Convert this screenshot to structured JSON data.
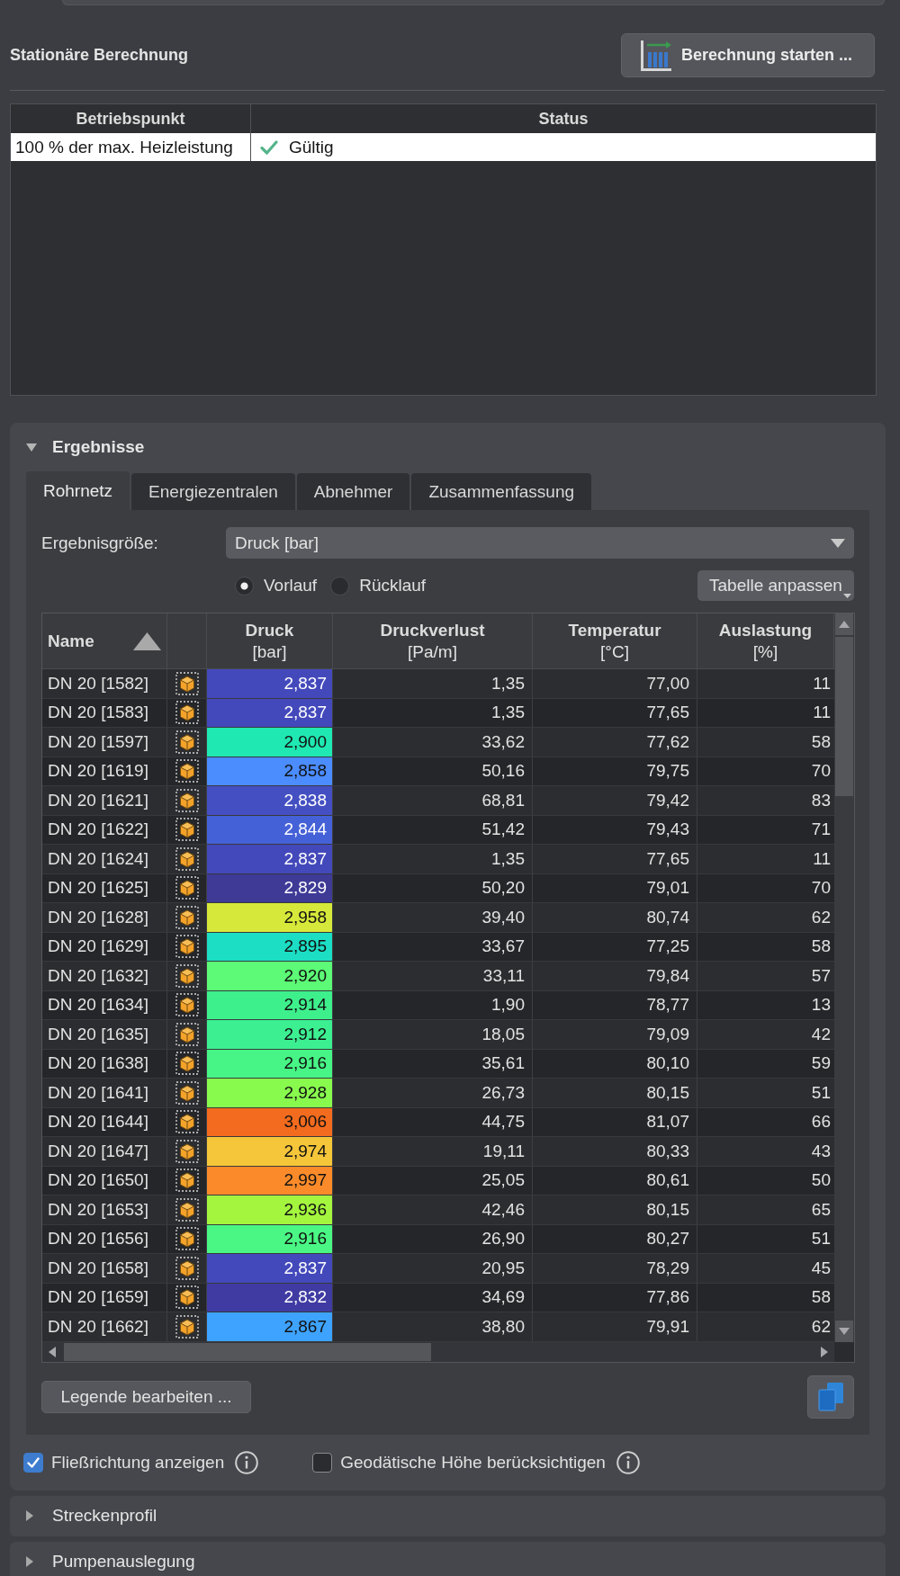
{
  "calculation": {
    "title": "Stationäre Berechnung",
    "start_button": "Berechnung starten ...",
    "table": {
      "columns": [
        "Betriebspunkt",
        "Status"
      ],
      "rows": [
        {
          "operating_point": "100 % der max. Heizleistung",
          "status": "Gültig",
          "valid": true,
          "selected": true
        }
      ]
    }
  },
  "results": {
    "title": "Ergebnisse",
    "expanded": true,
    "tabs": [
      {
        "label": "Rohrnetz",
        "selected": true
      },
      {
        "label": "Energiezentralen",
        "selected": false
      },
      {
        "label": "Abnehmer",
        "selected": false
      },
      {
        "label": "Zusammenfassung",
        "selected": false
      }
    ],
    "quantity": {
      "label": "Ergebnisgröße:",
      "value": "Druck [bar]"
    },
    "flow_options": [
      {
        "label": "Vorlauf",
        "selected": true
      },
      {
        "label": "Rücklauf",
        "selected": false
      }
    ],
    "customize_button": "Tabelle anpassen",
    "table": {
      "columns": [
        {
          "label": "Name",
          "sorted": true
        },
        {
          "label": "Druck",
          "unit": "[bar]",
          "sorted": false
        },
        {
          "label": "Druckverlust",
          "unit": "[Pa/m]",
          "sorted": false
        },
        {
          "label": "Temperatur",
          "unit": "[°C]",
          "sorted": false
        },
        {
          "label": "Auslastung",
          "unit": "[%]",
          "sorted": false
        }
      ],
      "rows": [
        {
          "name": "DN 20 [1582]",
          "pressure": "2,837",
          "color": "#4349bb",
          "pressure_loss": "1,35",
          "temperature": "77,00",
          "load": "11"
        },
        {
          "name": "DN 20 [1583]",
          "pressure": "2,837",
          "color": "#4349bb",
          "pressure_loss": "1,35",
          "temperature": "77,65",
          "load": "11"
        },
        {
          "name": "DN 20 [1597]",
          "pressure": "2,900",
          "color": "#20e8b2",
          "pressure_loss": "33,62",
          "temperature": "77,62",
          "load": "58"
        },
        {
          "name": "DN 20 [1619]",
          "pressure": "2,858",
          "color": "#4b8cff",
          "pressure_loss": "50,16",
          "temperature": "79,75",
          "load": "70"
        },
        {
          "name": "DN 20 [1621]",
          "pressure": "2,838",
          "color": "#4450c2",
          "pressure_loss": "68,81",
          "temperature": "79,42",
          "load": "83"
        },
        {
          "name": "DN 20 [1622]",
          "pressure": "2,844",
          "color": "#4561d8",
          "pressure_loss": "51,42",
          "temperature": "79,43",
          "load": "71"
        },
        {
          "name": "DN 20 [1624]",
          "pressure": "2,837",
          "color": "#4349bb",
          "pressure_loss": "1,35",
          "temperature": "77,65",
          "load": "11"
        },
        {
          "name": "DN 20 [1625]",
          "pressure": "2,829",
          "color": "#3e3a96",
          "pressure_loss": "50,20",
          "temperature": "79,01",
          "load": "70"
        },
        {
          "name": "DN 20 [1628]",
          "pressure": "2,958",
          "color": "#d6e83a",
          "pressure_loss": "39,40",
          "temperature": "80,74",
          "load": "62"
        },
        {
          "name": "DN 20 [1629]",
          "pressure": "2,895",
          "color": "#1cdec4",
          "pressure_loss": "33,67",
          "temperature": "77,25",
          "load": "58"
        },
        {
          "name": "DN 20 [1632]",
          "pressure": "2,920",
          "color": "#5cfa76",
          "pressure_loss": "33,11",
          "temperature": "79,84",
          "load": "57"
        },
        {
          "name": "DN 20 [1634]",
          "pressure": "2,914",
          "color": "#3ef08c",
          "pressure_loss": "1,90",
          "temperature": "78,77",
          "load": "13"
        },
        {
          "name": "DN 20 [1635]",
          "pressure": "2,912",
          "color": "#3cf092",
          "pressure_loss": "18,05",
          "temperature": "79,09",
          "load": "42"
        },
        {
          "name": "DN 20 [1638]",
          "pressure": "2,916",
          "color": "#47f586",
          "pressure_loss": "35,61",
          "temperature": "80,10",
          "load": "59"
        },
        {
          "name": "DN 20 [1641]",
          "pressure": "2,928",
          "color": "#88fa4e",
          "pressure_loss": "26,73",
          "temperature": "80,15",
          "load": "51"
        },
        {
          "name": "DN 20 [1644]",
          "pressure": "3,006",
          "color": "#f36b1e",
          "pressure_loss": "44,75",
          "temperature": "81,07",
          "load": "66"
        },
        {
          "name": "DN 20 [1647]",
          "pressure": "2,974",
          "color": "#f5c63a",
          "pressure_loss": "19,11",
          "temperature": "80,33",
          "load": "43"
        },
        {
          "name": "DN 20 [1650]",
          "pressure": "2,997",
          "color": "#fb8b2a",
          "pressure_loss": "25,05",
          "temperature": "80,61",
          "load": "50"
        },
        {
          "name": "DN 20 [1653]",
          "pressure": "2,936",
          "color": "#a4f53e",
          "pressure_loss": "42,46",
          "temperature": "80,15",
          "load": "65"
        },
        {
          "name": "DN 20 [1656]",
          "pressure": "2,916",
          "color": "#4af784",
          "pressure_loss": "26,90",
          "temperature": "80,27",
          "load": "51"
        },
        {
          "name": "DN 20 [1658]",
          "pressure": "2,837",
          "color": "#4349bb",
          "pressure_loss": "20,95",
          "temperature": "78,29",
          "load": "45"
        },
        {
          "name": "DN 20 [1659]",
          "pressure": "2,832",
          "color": "#3f3ba2",
          "pressure_loss": "34,69",
          "temperature": "77,86",
          "load": "58"
        },
        {
          "name": "DN 20 [1662]",
          "pressure": "2,867",
          "color": "#3ea3ff",
          "pressure_loss": "38,80",
          "temperature": "79,91",
          "load": "62"
        }
      ]
    },
    "legend_button": "Legende bearbeiten ...",
    "options": [
      {
        "label": "Fließrichtung anzeigen",
        "checked": true
      },
      {
        "label": "Geodätische Höhe berücksichtigen",
        "checked": false
      }
    ]
  },
  "sections": [
    {
      "title": "Streckenprofil",
      "expanded": false
    },
    {
      "title": "Pumpenauslegung",
      "expanded": false
    }
  ]
}
